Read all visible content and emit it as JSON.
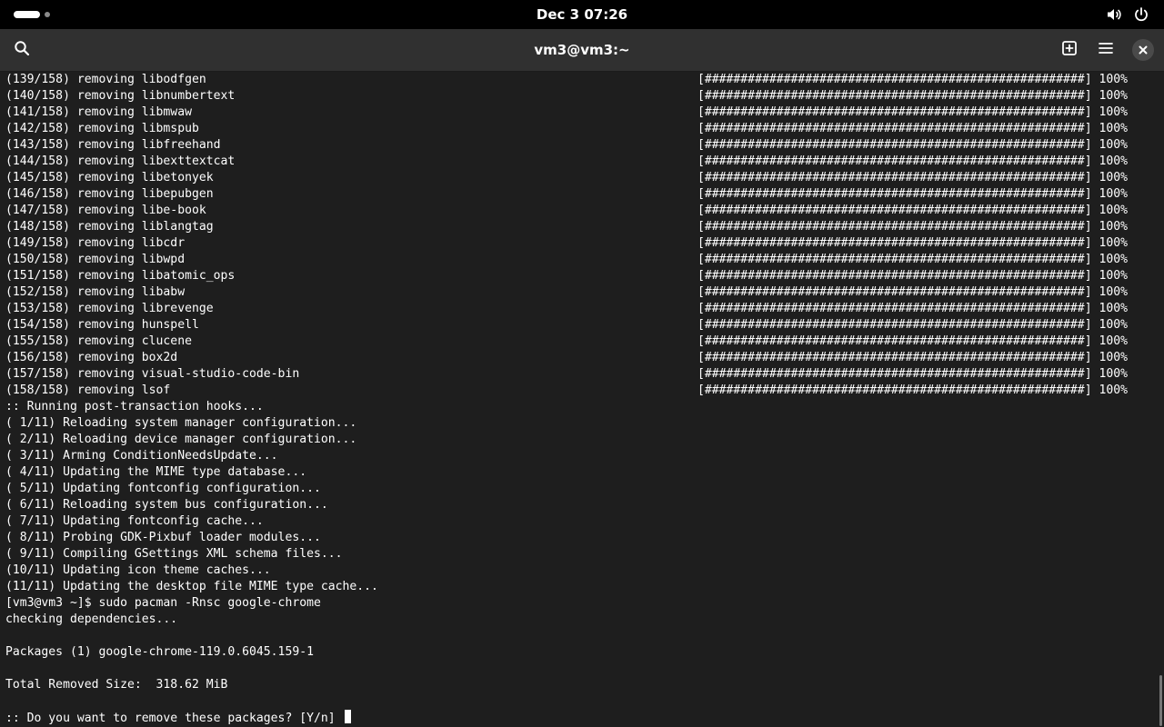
{
  "topbar": {
    "clock": "Dec 3  07:26"
  },
  "window": {
    "title": "vm3@vm3:~"
  },
  "terminal": {
    "progress_bar": "[#####################################################] 100%",
    "removal_lines": [
      "(139/158) removing libodfgen",
      "(140/158) removing libnumbertext",
      "(141/158) removing libmwaw",
      "(142/158) removing libmspub",
      "(143/158) removing libfreehand",
      "(144/158) removing libexttextcat",
      "(145/158) removing libetonyek",
      "(146/158) removing libepubgen",
      "(147/158) removing libe-book",
      "(148/158) removing liblangtag",
      "(149/158) removing libcdr",
      "(150/158) removing libwpd",
      "(151/158) removing libatomic_ops",
      "(152/158) removing libabw",
      "(153/158) removing librevenge",
      "(154/158) removing hunspell",
      "(155/158) removing clucene",
      "(156/158) removing box2d",
      "(157/158) removing visual-studio-code-bin",
      "(158/158) removing lsof"
    ],
    "hook_lines": [
      ":: Running post-transaction hooks...",
      "( 1/11) Reloading system manager configuration...",
      "( 2/11) Reloading device manager configuration...",
      "( 3/11) Arming ConditionNeedsUpdate...",
      "( 4/11) Updating the MIME type database...",
      "( 5/11) Updating fontconfig configuration...",
      "( 6/11) Reloading system bus configuration...",
      "( 7/11) Updating fontconfig cache...",
      "( 8/11) Probing GDK-Pixbuf loader modules...",
      "( 9/11) Compiling GSettings XML schema files...",
      "(10/11) Updating icon theme caches...",
      "(11/11) Updating the desktop file MIME type cache..."
    ],
    "command_line": "[vm3@vm3 ~]$ sudo pacman -Rnsc google-chrome",
    "checking_line": "checking dependencies...",
    "packages_line": "Packages (1) google-chrome-119.0.6045.159-1",
    "size_line": "Total Removed Size:  318.62 MiB",
    "prompt_line": ":: Do you want to remove these packages? [Y/n] "
  }
}
